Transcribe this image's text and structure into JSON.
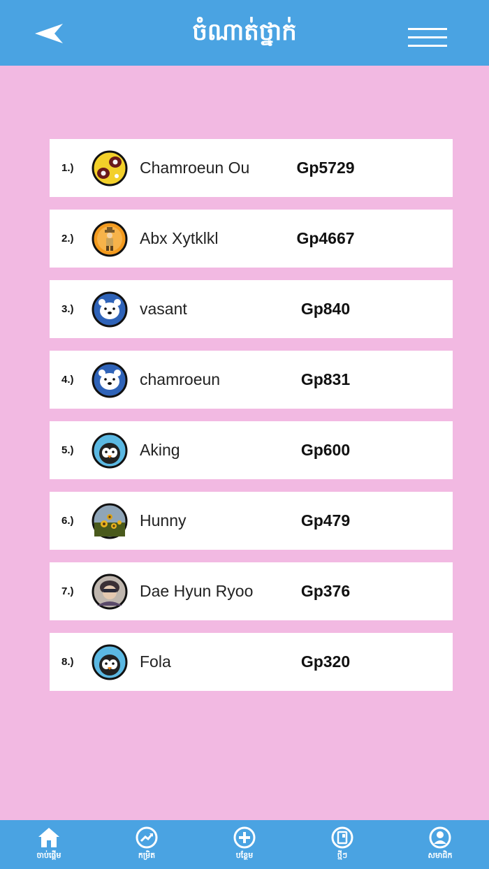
{
  "header": {
    "title": "ចំណាត់ថ្នាក់",
    "back_icon": "back-arrow-icon",
    "menu_icon": "hamburger-menu-icon"
  },
  "colors": {
    "header_bg": "#4aa3e2",
    "page_bg": "#f2b9e2",
    "row_bg": "#ffffff"
  },
  "leaderboard": {
    "rows": [
      {
        "rank": "1.)",
        "name": "Chamroeun Ou",
        "score": "Gp5729",
        "avatar": "cartoon-avatar"
      },
      {
        "rank": "2.)",
        "name": "Abx Xytklkl",
        "score": "Gp4667",
        "avatar": "explorer-avatar"
      },
      {
        "rank": "3.)",
        "name": "vasant",
        "score": "Gp840",
        "avatar": "polar-bear-avatar"
      },
      {
        "rank": "4.)",
        "name": "chamroeun",
        "score": "Gp831",
        "avatar": "polar-bear-avatar"
      },
      {
        "rank": "5.)",
        "name": "Aking",
        "score": "Gp600",
        "avatar": "penguin-avatar"
      },
      {
        "rank": "6.)",
        "name": "Hunny",
        "score": "Gp479",
        "avatar": "sunflower-photo-avatar"
      },
      {
        "rank": "7.)",
        "name": "Dae Hyun Ryoo",
        "score": "Gp376",
        "avatar": "person-photo-avatar"
      },
      {
        "rank": "8.)",
        "name": "Fola",
        "score": "Gp320",
        "avatar": "penguin-avatar"
      }
    ]
  },
  "bottom_nav": {
    "items": [
      {
        "label": "ចាប់ផ្តើម",
        "icon": "home-icon"
      },
      {
        "label": "កម្រិត",
        "icon": "trend-icon"
      },
      {
        "label": "បន្ថែម",
        "icon": "add-circle-icon"
      },
      {
        "label": "ថ្មីៗ",
        "icon": "notebook-icon"
      },
      {
        "label": "សមាជិក",
        "icon": "user-circle-icon"
      }
    ]
  }
}
